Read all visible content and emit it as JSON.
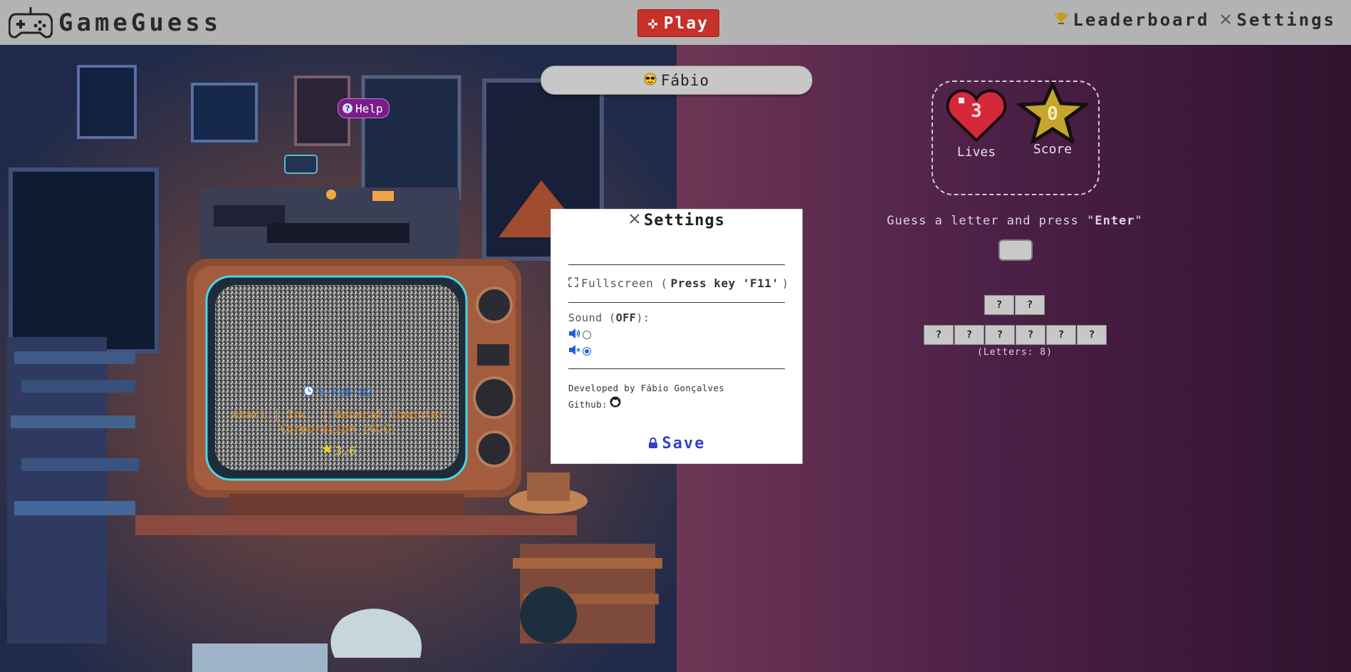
{
  "app": {
    "title": "GameGuess"
  },
  "topbar": {
    "play_label": "Play",
    "leaderboard_label": "Leaderboard",
    "settings_label": "Settings"
  },
  "help": {
    "label": "Help"
  },
  "player": {
    "name": "Fábio"
  },
  "game_card": {
    "date": "3-Feb-82",
    "publisher": "Atari | Inc. | General Computer Corporation (GCC)",
    "rating": "3.6"
  },
  "stats": {
    "lives_label": "Lives",
    "lives_value": "3",
    "score_label": "Score",
    "score_value": "0"
  },
  "guess": {
    "prompt_prefix": "Guess a letter and press \"",
    "prompt_key": "Enter",
    "prompt_suffix": "\"",
    "input_value": ""
  },
  "word": {
    "row1": [
      "?",
      "?"
    ],
    "row2": [
      "?",
      "?",
      "?",
      "?",
      "?",
      "?"
    ],
    "letters_label": "(Letters: 8)"
  },
  "settings_modal": {
    "title": "Settings",
    "fullscreen_label": "Fullscreen (",
    "fullscreen_hint": "Press key 'F11'",
    "fullscreen_close": ")",
    "sound_label": "Sound (",
    "sound_state": "OFF",
    "sound_close": "):",
    "sound_on_selected": false,
    "sound_off_selected": true,
    "developed_by": "Developed by Fábio Gonçalves",
    "github_label": "Github:",
    "save_label": "Save"
  },
  "colors": {
    "topbar": "#b3b3b3",
    "play_button": "#c8302a",
    "right_panel_start": "#6d3655",
    "right_panel_end": "#30122e",
    "save_text": "#3341c4",
    "date_text": "#2a6fd6",
    "publisher_text": "#e0891c",
    "rating_text": "#e8d022"
  }
}
